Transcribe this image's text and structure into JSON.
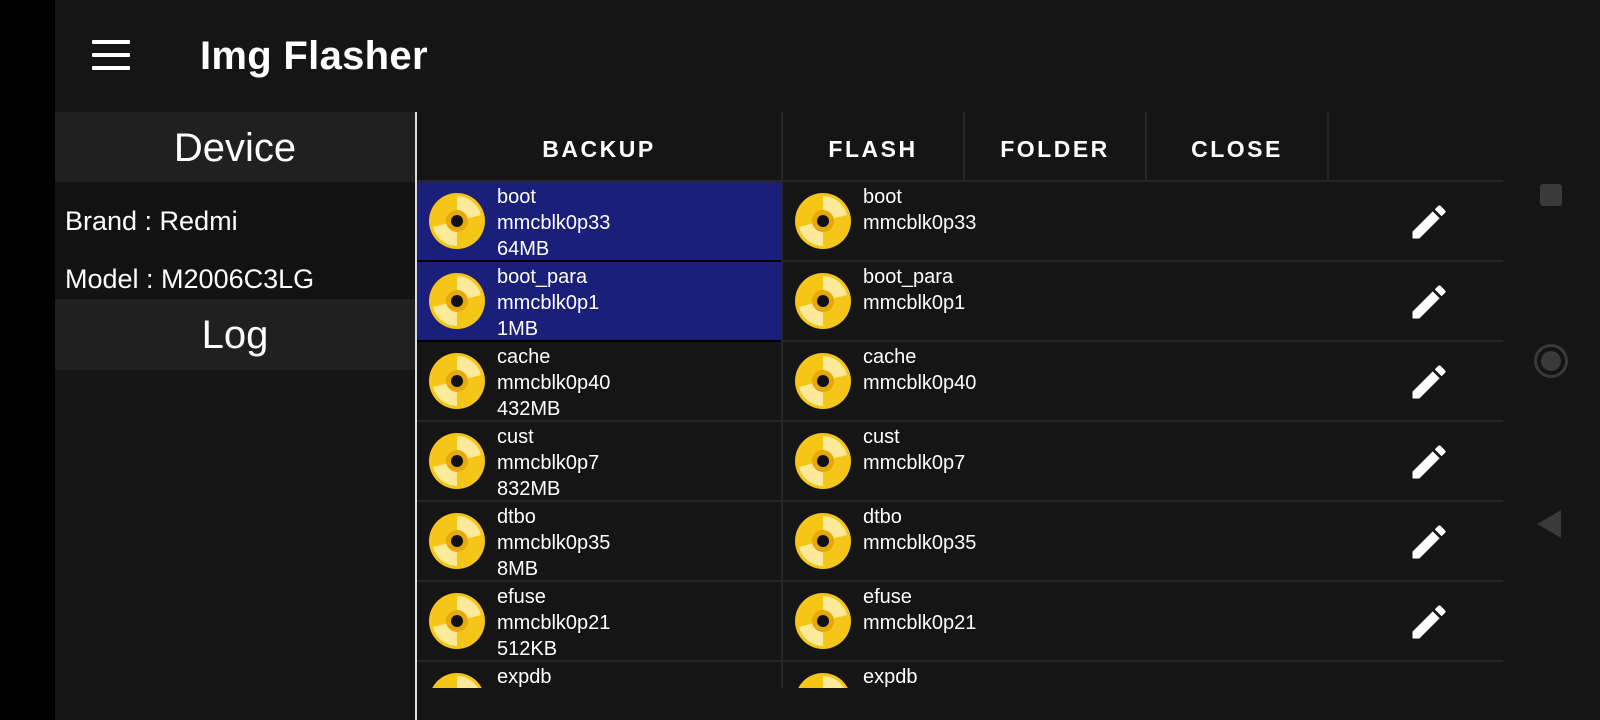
{
  "app": {
    "title": "Img Flasher"
  },
  "device": {
    "header": "Device",
    "brand": "Brand : Redmi",
    "model": "Model : M2006C3LG"
  },
  "log": {
    "header": "Log"
  },
  "tabs": [
    "BACKUP",
    "FLASH",
    "FOLDER",
    "CLOSE"
  ],
  "colors": {
    "selected": "#1a1f7a",
    "disc": "#f5c518",
    "background": "#151515"
  },
  "icons": {
    "partition": "disc-icon",
    "edit": "pencil-icon",
    "menu": "hamburger-menu-icon"
  },
  "partitions": [
    {
      "name": "boot",
      "device": "mmcblk0p33",
      "size": "64MB",
      "selected": true
    },
    {
      "name": "boot_para",
      "device": "mmcblk0p1",
      "size": "1MB",
      "selected": true
    },
    {
      "name": "cache",
      "device": "mmcblk0p40",
      "size": "432MB",
      "selected": false
    },
    {
      "name": "cust",
      "device": "mmcblk0p7",
      "size": "832MB",
      "selected": false
    },
    {
      "name": "dtbo",
      "device": "mmcblk0p35",
      "size": "8MB",
      "selected": false
    },
    {
      "name": "efuse",
      "device": "mmcblk0p21",
      "size": "512KB",
      "selected": false
    },
    {
      "name": "expdb",
      "device": "",
      "size": "",
      "selected": false
    }
  ]
}
